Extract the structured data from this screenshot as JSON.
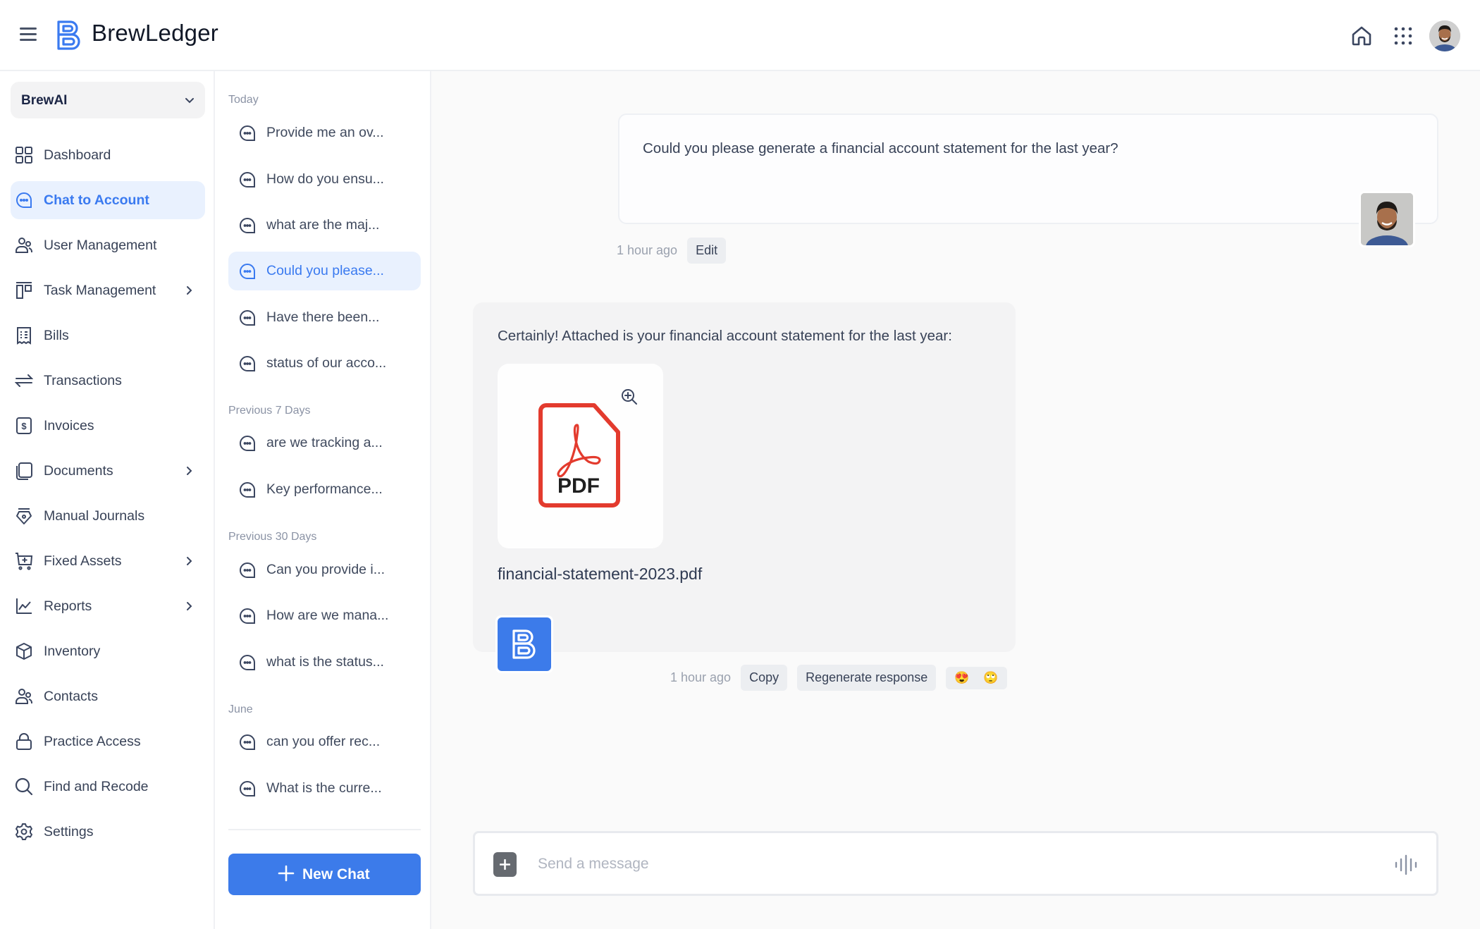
{
  "header": {
    "brand": "BrewLedger",
    "brand_color": "#3a7af0",
    "icons": [
      "menu-icon",
      "home-icon",
      "apps-grid-icon",
      "user-avatar"
    ]
  },
  "sidebar": {
    "org_selector": "BrewAI",
    "items": [
      {
        "label": "Dashboard",
        "icon": "dashboard-icon",
        "has_submenu": false,
        "active": false
      },
      {
        "label": "Chat to Account",
        "icon": "chat-icon",
        "has_submenu": false,
        "active": true
      },
      {
        "label": "User Management",
        "icon": "users-icon",
        "has_submenu": false,
        "active": false
      },
      {
        "label": "Task Management",
        "icon": "kanban-icon",
        "has_submenu": true,
        "active": false
      },
      {
        "label": "Bills",
        "icon": "receipt-icon",
        "has_submenu": false,
        "active": false
      },
      {
        "label": "Transactions",
        "icon": "arrows-swap-icon",
        "has_submenu": false,
        "active": false
      },
      {
        "label": "Invoices",
        "icon": "invoice-dollar-icon",
        "has_submenu": false,
        "active": false
      },
      {
        "label": "Documents",
        "icon": "documents-icon",
        "has_submenu": true,
        "active": false
      },
      {
        "label": "Manual Journals",
        "icon": "pen-nib-icon",
        "has_submenu": false,
        "active": false
      },
      {
        "label": "Fixed Assets",
        "icon": "cart-plus-icon",
        "has_submenu": true,
        "active": false
      },
      {
        "label": "Reports",
        "icon": "line-chart-icon",
        "has_submenu": true,
        "active": false
      },
      {
        "label": "Inventory",
        "icon": "box-icon",
        "has_submenu": false,
        "active": false
      },
      {
        "label": "Contacts",
        "icon": "contacts-icon",
        "has_submenu": false,
        "active": false
      },
      {
        "label": "Practice Access",
        "icon": "lock-icon",
        "has_submenu": false,
        "active": false
      },
      {
        "label": "Find and Recode",
        "icon": "search-icon",
        "has_submenu": false,
        "active": false
      },
      {
        "label": "Settings",
        "icon": "gear-icon",
        "has_submenu": false,
        "active": false
      }
    ]
  },
  "history": {
    "groups": [
      {
        "label": "Today",
        "items": [
          {
            "label": "Provide me an ov...",
            "active": false
          },
          {
            "label": "How do you ensu...",
            "active": false
          },
          {
            "label": "what are the maj...",
            "active": false
          },
          {
            "label": "Could you please...",
            "active": true
          },
          {
            "label": "Have there been...",
            "active": false
          },
          {
            "label": "status of our acco...",
            "active": false
          }
        ]
      },
      {
        "label": "Previous 7 Days",
        "items": [
          {
            "label": "are we tracking a...",
            "active": false
          },
          {
            "label": "Key performance...",
            "active": false
          }
        ]
      },
      {
        "label": "Previous 30 Days",
        "items": [
          {
            "label": "Can you provide i...",
            "active": false
          },
          {
            "label": "How are we mana...",
            "active": false
          },
          {
            "label": "what is the status...",
            "active": false
          }
        ]
      },
      {
        "label": "June",
        "items": [
          {
            "label": "can you offer rec...",
            "active": false
          },
          {
            "label": "What is the curre...",
            "active": false
          }
        ]
      }
    ],
    "new_chat_label": "New Chat"
  },
  "conversation": {
    "user_message": {
      "text": "Could you please generate a financial account statement for the last year?",
      "timestamp": "1 hour ago",
      "edit_label": "Edit"
    },
    "assistant_message": {
      "text": "Certainly! Attached is your financial account statement for the last year:",
      "attachment": {
        "type": "PDF",
        "filename": "financial-statement-2023.pdf",
        "type_label": "PDF"
      },
      "timestamp": "1 hour ago",
      "copy_label": "Copy",
      "regenerate_label": "Regenerate response",
      "reactions": [
        "😍",
        "🙄"
      ]
    }
  },
  "composer": {
    "placeholder": "Send a message",
    "value": ""
  }
}
